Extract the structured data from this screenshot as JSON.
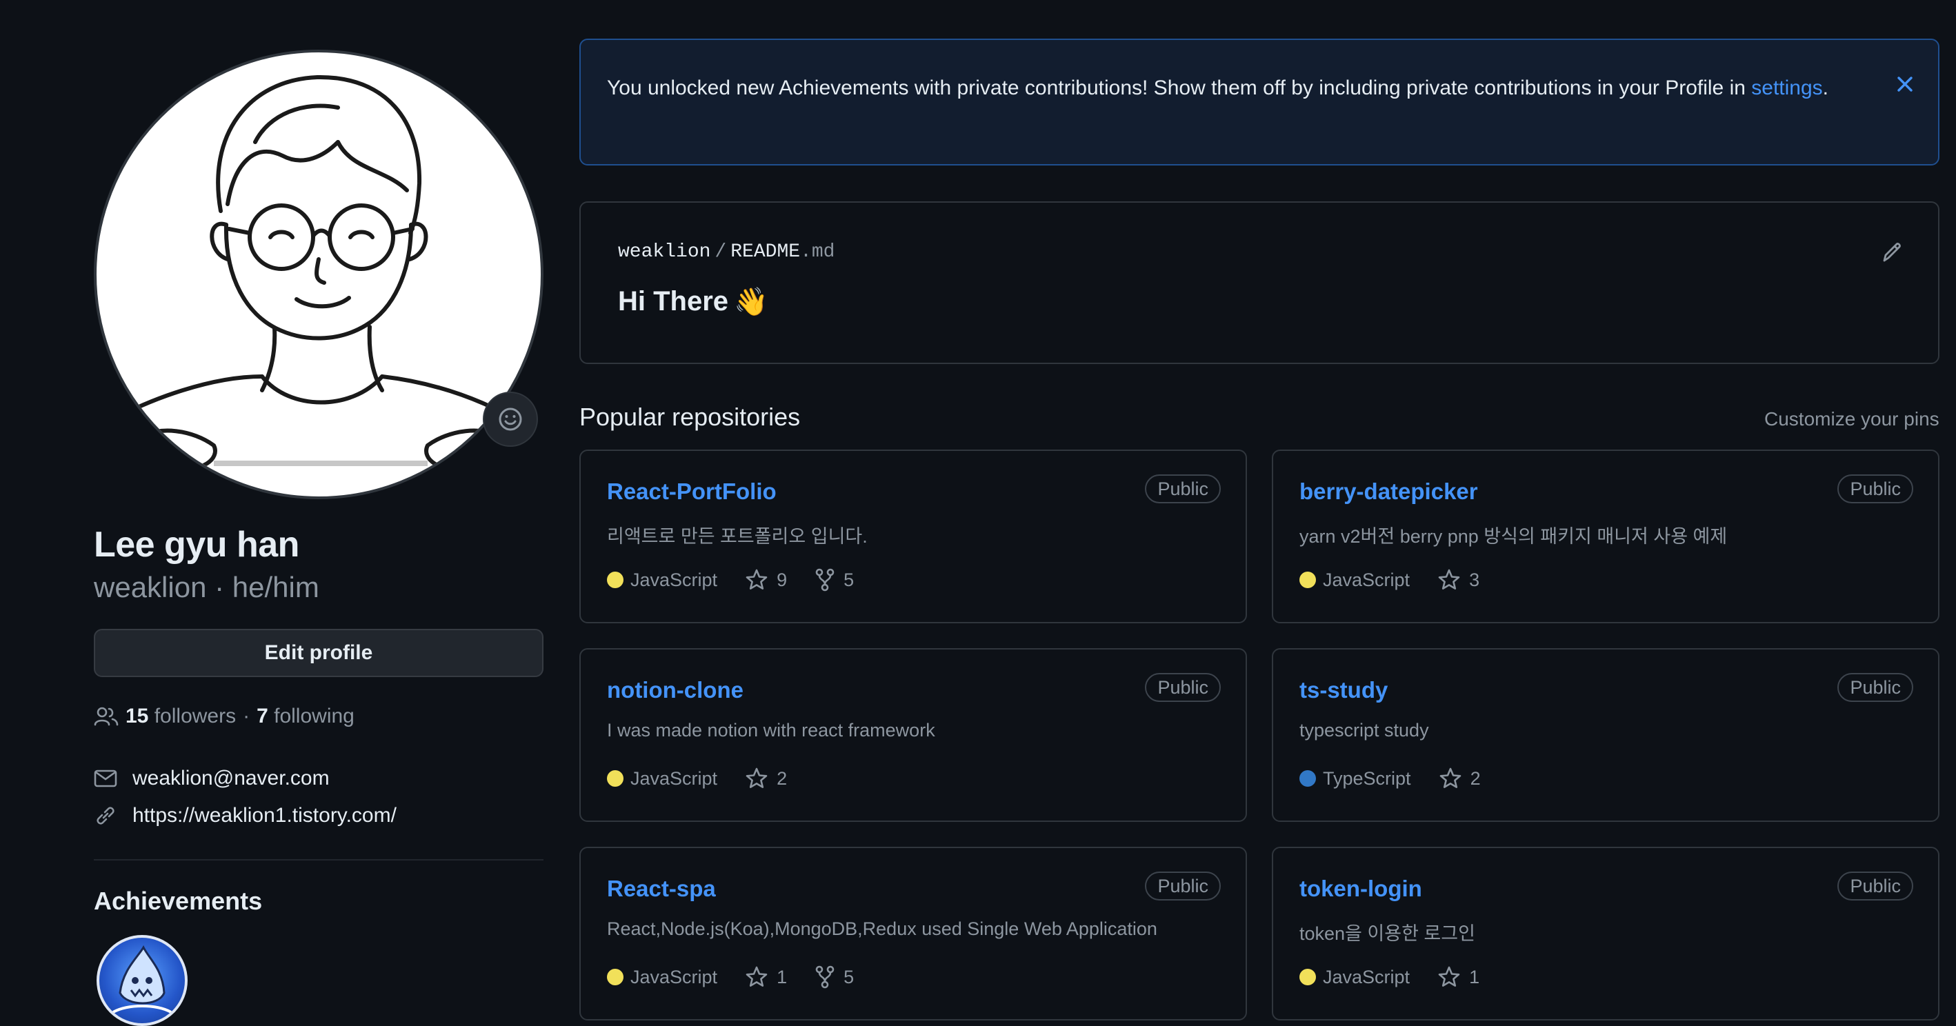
{
  "profile": {
    "fullname": "Lee gyu han",
    "subname": "weaklion · he/him",
    "edit_label": "Edit profile",
    "followers_count": "15",
    "followers_label": "followers",
    "separator": "·",
    "following_count": "7",
    "following_label": "following",
    "email": "weaklion@naver.com",
    "website": "https://weaklion1.tistory.com/",
    "achievements_title": "Achievements"
  },
  "banner": {
    "text": "You unlocked new Achievements with private contributions! Show them off by including private contributions in your Profile in ",
    "link": "settings",
    "end": "."
  },
  "readme": {
    "owner": "weaklion",
    "slash": "/",
    "file_base": "README",
    "file_ext": ".md",
    "heading": "Hi There",
    "heading_emoji": "👋"
  },
  "popular": {
    "title": "Popular repositories",
    "customize": "Customize your pins"
  },
  "repos": [
    {
      "name": "React-PortFolio",
      "visibility": "Public",
      "description": "리액트로 만든 포트폴리오 입니다.",
      "language": "JavaScript",
      "lang_color": "#f1e05a",
      "stars": "9",
      "forks": "5"
    },
    {
      "name": "berry-datepicker",
      "visibility": "Public",
      "description": "yarn v2버전 berry pnp 방식의 패키지 매니저 사용 예제",
      "language": "JavaScript",
      "lang_color": "#f1e05a",
      "stars": "3",
      "forks": ""
    },
    {
      "name": "notion-clone",
      "visibility": "Public",
      "description": "I was made notion with react framework",
      "language": "JavaScript",
      "lang_color": "#f1e05a",
      "stars": "2",
      "forks": ""
    },
    {
      "name": "ts-study",
      "visibility": "Public",
      "description": "typescript study",
      "language": "TypeScript",
      "lang_color": "#3178c6",
      "stars": "2",
      "forks": ""
    },
    {
      "name": "React-spa",
      "visibility": "Public",
      "description": "React,Node.js(Koa),MongoDB,Redux used Single Web Application",
      "language": "JavaScript",
      "lang_color": "#f1e05a",
      "stars": "1",
      "forks": "5"
    },
    {
      "name": "token-login",
      "visibility": "Public",
      "description": "token을 이용한 로그인",
      "language": "JavaScript",
      "lang_color": "#f1e05a",
      "stars": "1",
      "forks": ""
    }
  ],
  "colors": {
    "background": "#0d1117",
    "link": "#4493f8",
    "muted": "#8d96a0",
    "border": "#30363d",
    "banner_bg": "#121d2f"
  }
}
